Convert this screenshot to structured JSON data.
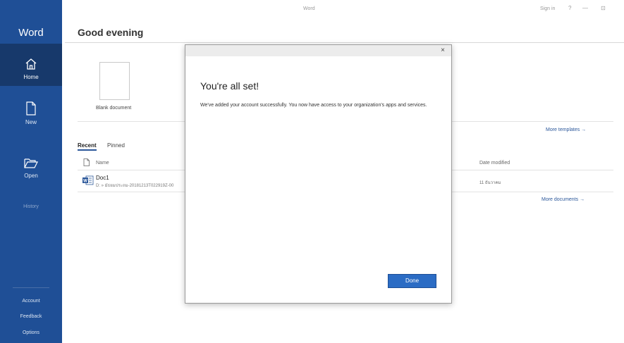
{
  "app": {
    "name": "Word",
    "window_title": "Word"
  },
  "titlebar": {
    "signin": "Sign in",
    "help": "?",
    "minimize": "—",
    "maximize": "⊡"
  },
  "sidebar": {
    "items": [
      {
        "label": "Home",
        "icon": "home-icon",
        "active": true
      },
      {
        "label": "New",
        "icon": "new-document-icon"
      },
      {
        "label": "Open",
        "icon": "folder-icon"
      },
      {
        "label": "History"
      }
    ],
    "bottom": [
      "Account",
      "Feedback",
      "Options"
    ]
  },
  "main": {
    "greeting": "Good evening",
    "blank_document": "Blank document",
    "more_templates": "More templates →",
    "tabs": [
      "Recent",
      "Pinned"
    ],
    "columns": {
      "name": "Name",
      "date": "Date modified"
    },
    "documents": [
      {
        "title": "Doc1",
        "path": "D: » มัธยมประถม-20181213T022919Z-00",
        "date": "11 ธันวาคม"
      }
    ],
    "more_documents": "More documents →"
  },
  "dialog": {
    "close": "×",
    "title": "You're all set!",
    "message": "We've added your account successfully. You now have access to your organization's apps and services.",
    "done": "Done"
  },
  "colors": {
    "sidebar": "#1f4f96",
    "accent": "#2b579a",
    "button": "#2b6cc4"
  }
}
